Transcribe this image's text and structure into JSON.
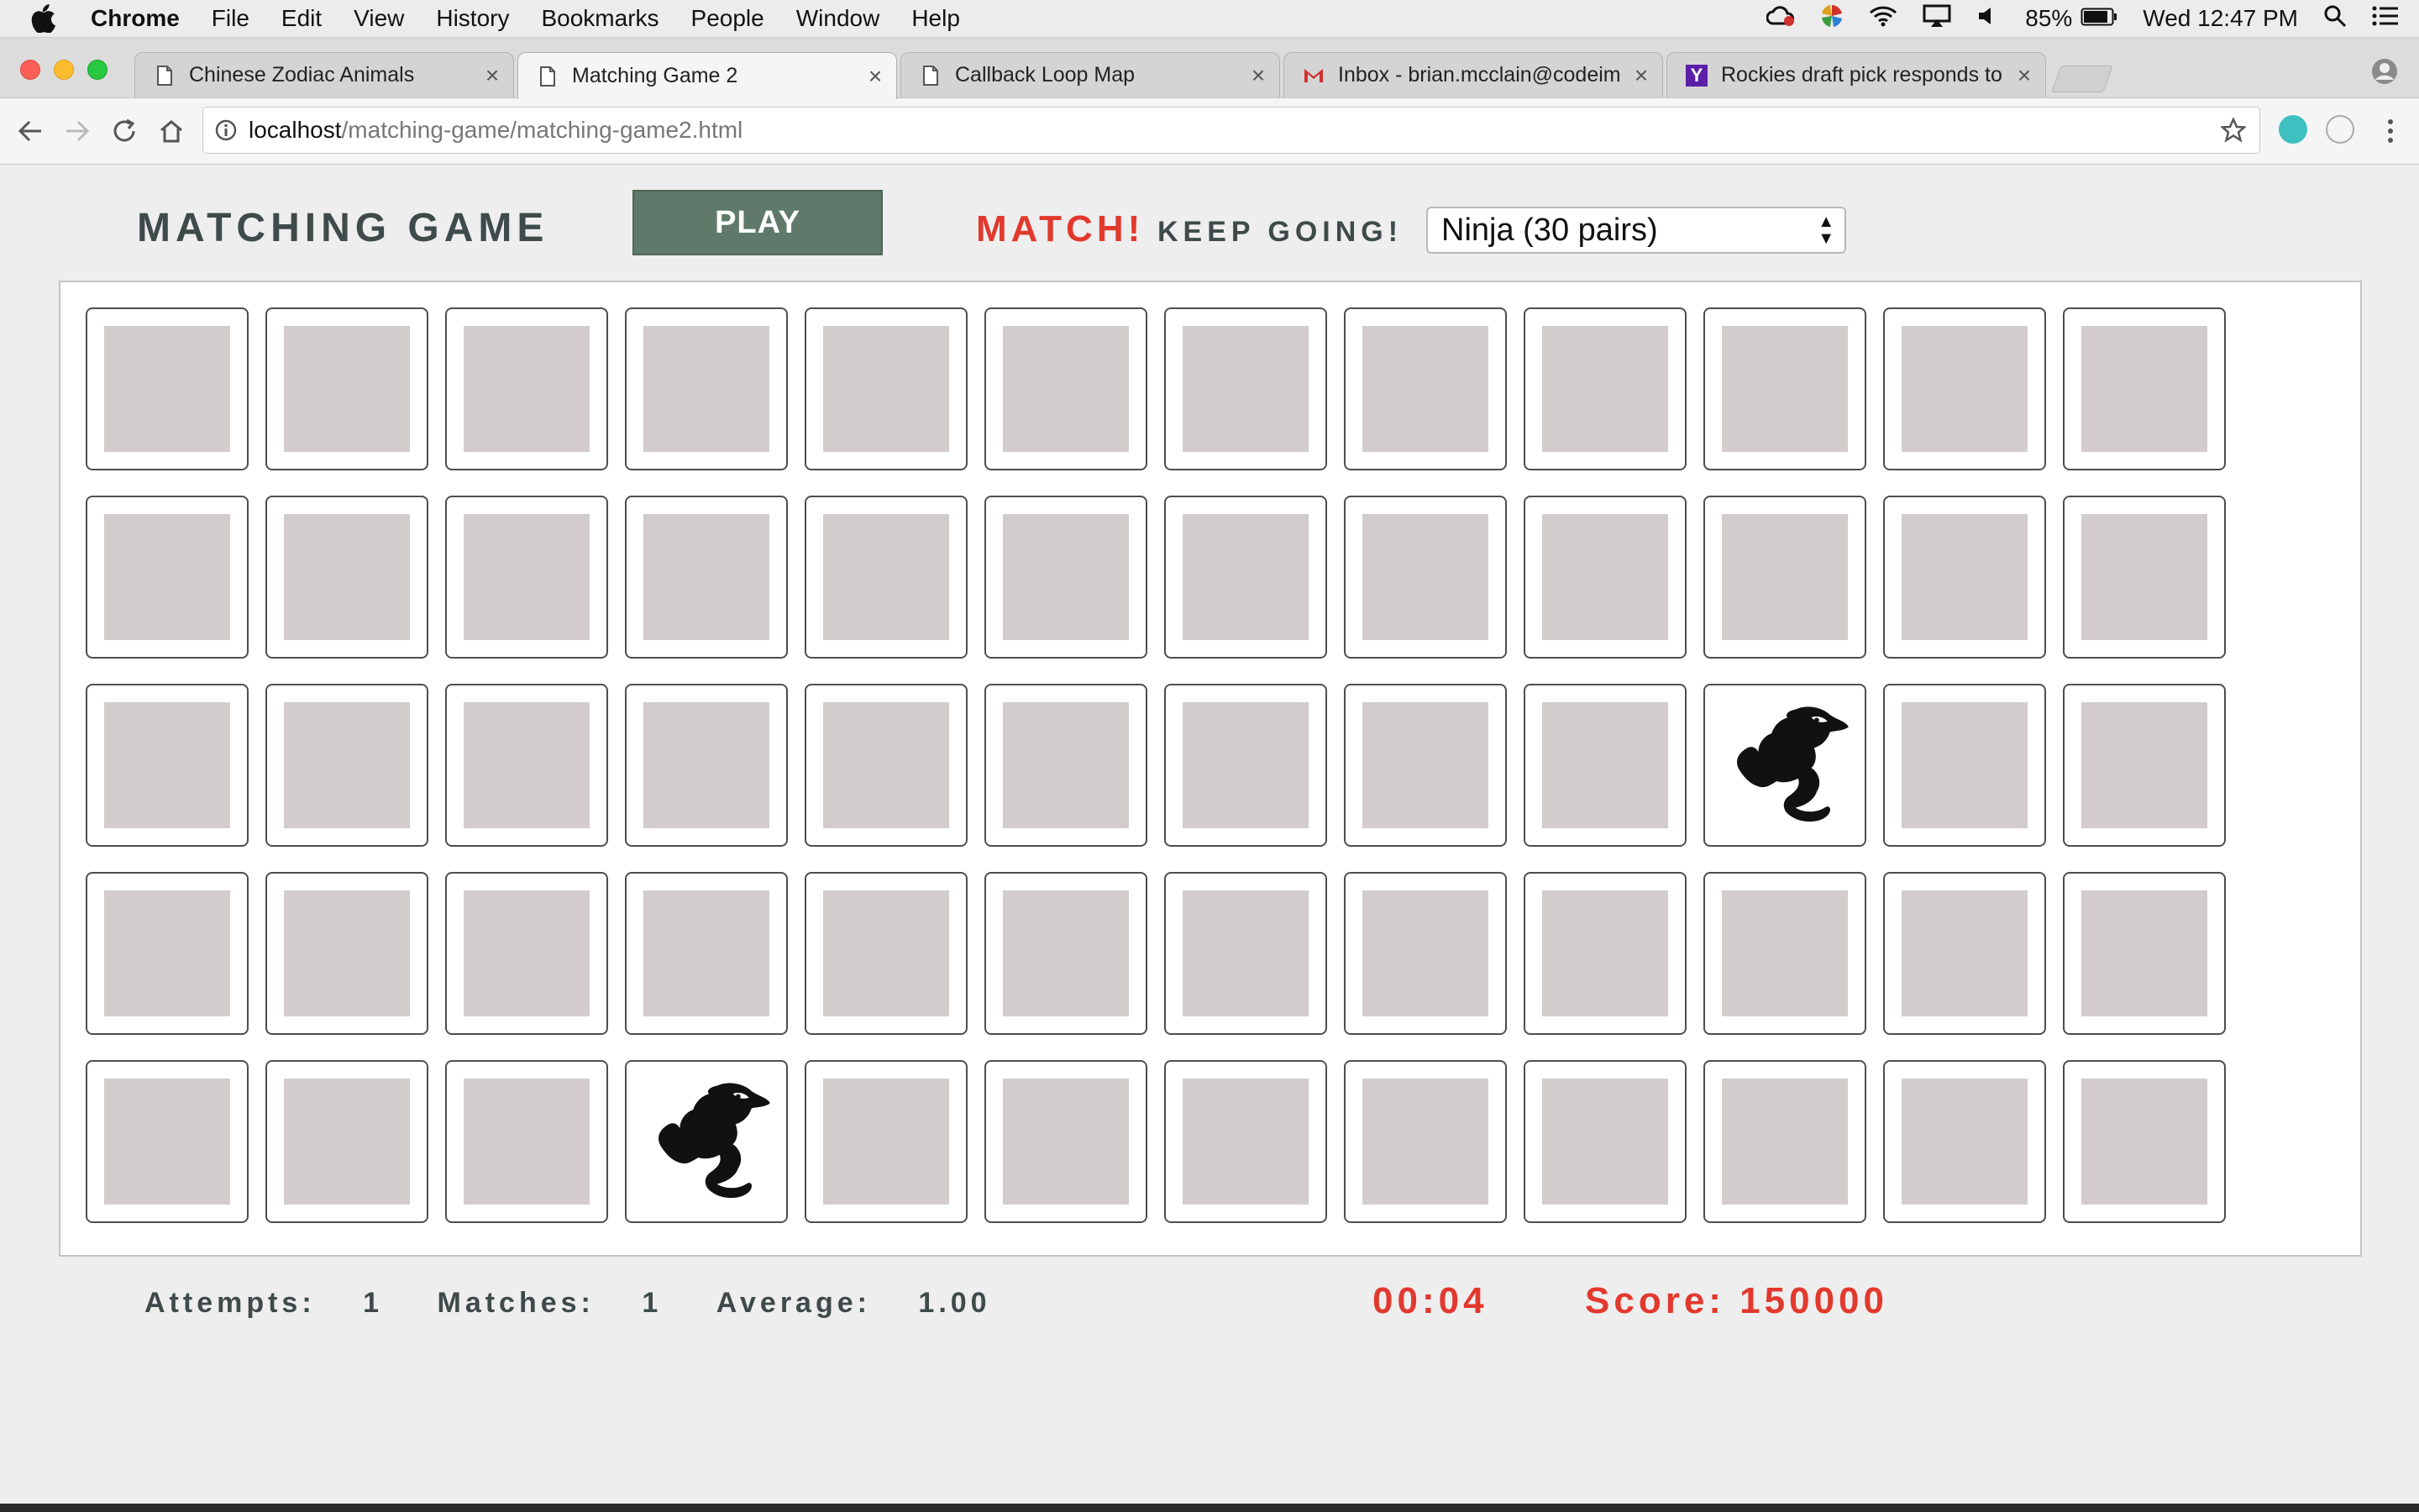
{
  "menubar": {
    "app_name": "Chrome",
    "items": [
      "File",
      "Edit",
      "View",
      "History",
      "Bookmarks",
      "People",
      "Window",
      "Help"
    ],
    "battery": "85%",
    "clock": "Wed 12:47 PM"
  },
  "tabs": [
    {
      "title": "Chinese Zodiac Animals",
      "icon": "document-icon"
    },
    {
      "title": "Matching Game 2",
      "icon": "document-icon",
      "active": true
    },
    {
      "title": "Callback Loop Map",
      "icon": "document-icon"
    },
    {
      "title": "Inbox - brian.mcclain@codeim",
      "icon": "gmail-icon"
    },
    {
      "title": "Rockies draft pick responds to",
      "icon": "yahoo-icon"
    }
  ],
  "address_bar": {
    "host": "localhost",
    "path": "/matching-game/matching-game2.html"
  },
  "game": {
    "title": "MATCHING GAME",
    "play_label": "PLAY",
    "match_label": "MATCH!",
    "keep_going_label": "KEEP GOING!",
    "difficulty_selected": "Ninja (30 pairs)",
    "grid": {
      "rows": 5,
      "cols": 12
    },
    "revealed_cards": [
      {
        "row": 3,
        "col": 10,
        "image": "seahorse"
      },
      {
        "row": 5,
        "col": 4,
        "image": "seahorse"
      }
    ],
    "stats": {
      "attempts_label": "Attempts:",
      "attempts_value": "1",
      "matches_label": "Matches:",
      "matches_value": "1",
      "average_label": "Average:",
      "average_value": "1.00"
    },
    "timer": "00:04",
    "score": "Score: 150000"
  },
  "colors": {
    "accent_red": "#e2392e",
    "play_button": "#5f7a6a",
    "card_back": "#d2cccc",
    "heading": "#3f4a4a"
  }
}
